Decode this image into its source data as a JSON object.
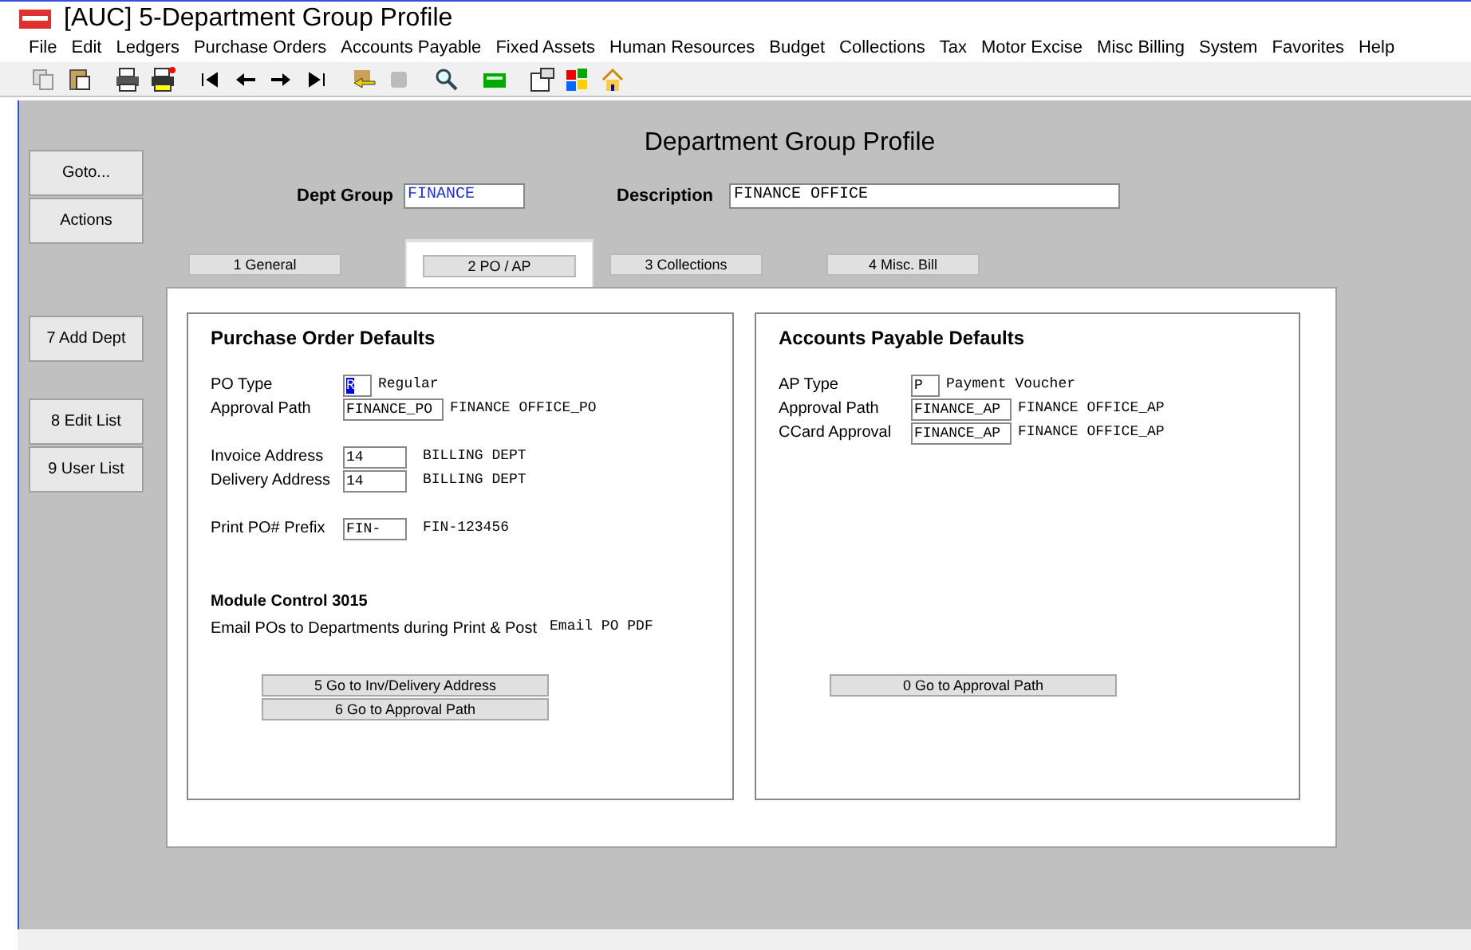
{
  "window": {
    "title": "[AUC] 5-Department Group Profile"
  },
  "menu": [
    "File",
    "Edit",
    "Ledgers",
    "Purchase Orders",
    "Accounts Payable",
    "Fixed Assets",
    "Human Resources",
    "Budget",
    "Collections",
    "Tax",
    "Motor Excise",
    "Misc Billing",
    "System",
    "Favorites",
    "Help"
  ],
  "side_buttons": [
    "Goto...",
    "Actions",
    "7 Add Dept",
    "8 Edit List",
    "9 User List"
  ],
  "heading": "Department Group Profile",
  "header_fields": [
    {
      "label": "Dept Group",
      "value": "FINANCE",
      "accent": true
    },
    {
      "label": "Description",
      "value": "FINANCE OFFICE",
      "accent": false
    }
  ],
  "tabs": [
    {
      "label": "1 General",
      "selected": false
    },
    {
      "label": "2 PO / AP",
      "selected": true
    },
    {
      "label": "3 Collections",
      "selected": false
    },
    {
      "label": "4 Misc. Bill",
      "selected": false
    }
  ],
  "panels": [
    {
      "title": "Purchase Order Defaults",
      "groups": [
        [
          {
            "label": "PO Type",
            "value": "R",
            "highlighted": true,
            "desc": "Regular"
          },
          {
            "label": "Approval Path",
            "value": "FINANCE_PO",
            "highlighted": false,
            "desc": "FINANCE OFFICE_PO"
          }
        ],
        [
          {
            "label": "Invoice Address",
            "value": "14",
            "highlighted": false,
            "desc": "BILLING DEPT"
          },
          {
            "label": "Delivery Address",
            "value": "14",
            "highlighted": false,
            "desc": "BILLING DEPT"
          }
        ],
        [
          {
            "label": "Print PO# Prefix",
            "value": "FIN-",
            "highlighted": false,
            "desc": "FIN-123456"
          }
        ]
      ],
      "note": {
        "title": "Module Control 3015",
        "text": "Email POs to Departments during Print & Post",
        "value": "Email PO PDF"
      },
      "buttons": [
        "5 Go to Inv/Delivery Address",
        "6 Go to Approval Path"
      ]
    },
    {
      "title": "Accounts Payable Defaults",
      "groups": [
        [
          {
            "label": "AP Type",
            "value": "P",
            "highlighted": false,
            "desc": "Payment Voucher"
          },
          {
            "label": "Approval Path",
            "value": "FINANCE_AP",
            "highlighted": false,
            "desc": "FINANCE OFFICE_AP"
          },
          {
            "label": "CCard Approval",
            "value": "FINANCE_AP",
            "highlighted": false,
            "desc": "FINANCE OFFICE_AP"
          }
        ]
      ],
      "buttons": [
        "0 Go to Approval Path"
      ]
    }
  ]
}
